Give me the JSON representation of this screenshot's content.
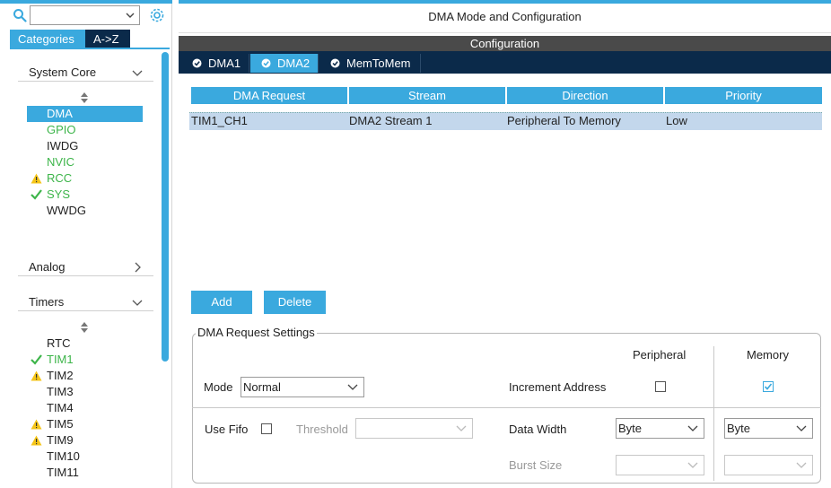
{
  "sidebar": {
    "search": {
      "value": ""
    },
    "tabs": [
      {
        "label": "Categories"
      },
      {
        "label": "A->Z"
      }
    ],
    "sections": [
      {
        "title": "System Core",
        "expanded": true
      },
      {
        "title": "Analog",
        "expanded": false
      },
      {
        "title": "Timers",
        "expanded": true
      }
    ],
    "system_core_items": [
      {
        "label": "DMA",
        "status": "selected"
      },
      {
        "label": "GPIO",
        "status": "configured"
      },
      {
        "label": "IWDG",
        "status": "none"
      },
      {
        "label": "NVIC",
        "status": "configured"
      },
      {
        "label": "RCC",
        "status": "warning",
        "icon": "warning-icon"
      },
      {
        "label": "SYS",
        "status": "ok",
        "icon": "check-icon"
      },
      {
        "label": "WWDG",
        "status": "none"
      }
    ],
    "timers_items": [
      {
        "label": "RTC",
        "status": "none"
      },
      {
        "label": "TIM1",
        "status": "ok",
        "icon": "check-icon"
      },
      {
        "label": "TIM2",
        "status": "warning",
        "icon": "warning-icon"
      },
      {
        "label": "TIM3",
        "status": "none"
      },
      {
        "label": "TIM4",
        "status": "none"
      },
      {
        "label": "TIM5",
        "status": "warning",
        "icon": "warning-icon"
      },
      {
        "label": "TIM9",
        "status": "warning",
        "icon": "warning-icon"
      },
      {
        "label": "TIM10",
        "status": "none"
      },
      {
        "label": "TIM11",
        "status": "none"
      }
    ]
  },
  "main": {
    "title": "DMA Mode and Configuration",
    "config_label": "Configuration",
    "dma_tabs": [
      {
        "label": "DMA1",
        "active": false
      },
      {
        "label": "DMA2",
        "active": true
      },
      {
        "label": "MemToMem",
        "active": false
      }
    ],
    "table": {
      "headers": [
        "DMA Request",
        "Stream",
        "Direction",
        "Priority"
      ],
      "rows": [
        [
          "TIM1_CH1",
          "DMA2 Stream 1",
          "Peripheral To Memory",
          "Low"
        ]
      ]
    },
    "buttons": {
      "add": "Add",
      "delete": "Delete"
    },
    "settings": {
      "title": "DMA Request Settings",
      "peripheral_label": "Peripheral",
      "memory_label": "Memory",
      "mode_label": "Mode",
      "mode_value": "Normal",
      "increment_label": "Increment Address",
      "increment_peripheral": false,
      "increment_memory": true,
      "use_fifo_label": "Use Fifo",
      "use_fifo": false,
      "threshold_label": "Threshold",
      "threshold_value": "",
      "data_width_label": "Data Width",
      "data_width_peripheral": "Byte",
      "data_width_memory": "Byte",
      "burst_size_label": "Burst Size",
      "burst_peripheral": "",
      "burst_memory": ""
    }
  },
  "colors": {
    "accent": "#3aa9de",
    "dark_nav": "#0b2a4a",
    "green": "#3db54a",
    "warning": "#f5c518"
  }
}
